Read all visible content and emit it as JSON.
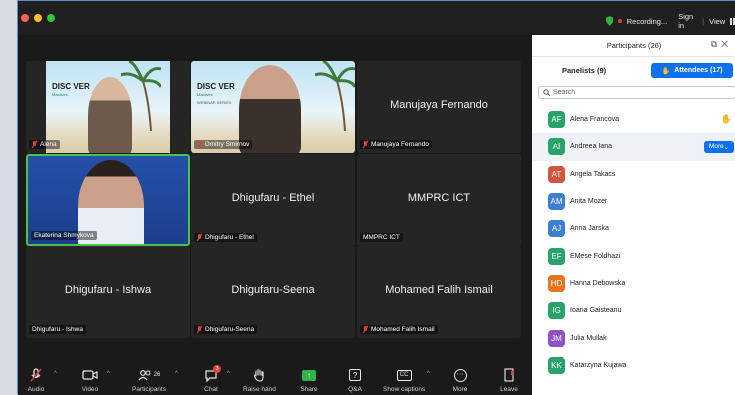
{
  "titlebar": {
    "recording": "Recording...",
    "sign_in": "Sign in",
    "separator": "|",
    "view": "View"
  },
  "tiles": [
    {
      "name": "Alena",
      "video": true,
      "muted": true
    },
    {
      "name": "Dmitry Smirnov",
      "video": true,
      "muted": true
    },
    {
      "name": "Manujaya Fernando",
      "label": "Manujaya Fernando",
      "video": false,
      "muted": true
    },
    {
      "name": "Ekaterina Shmykova",
      "video": true,
      "muted": false,
      "active": true
    },
    {
      "name": "Dhigufaru - Ethel",
      "label": "Dhigufaru - Ethel",
      "video": false,
      "muted": true
    },
    {
      "name": "MMPRC ICT",
      "label": "MMPRC ICT",
      "video": false,
      "muted": false
    },
    {
      "name": "Dhigufaru - Ishwa",
      "label": "Dhigufaru - Ishwa",
      "video": false,
      "muted": false
    },
    {
      "name": "Dhigufaru-Seena",
      "label": "Dhigufaru-Seena",
      "video": false,
      "muted": true
    },
    {
      "name": "Mohamed Falih Ismail",
      "label": "Mohamed Falih Ismail",
      "video": false,
      "muted": true
    }
  ],
  "logo": {
    "title": "DISC VER",
    "sub": "Maldives",
    "series": "WEBINAR SERIES"
  },
  "toolbar": {
    "audio": "Audio",
    "video": "Video",
    "participants": "Participants",
    "participants_count": "26",
    "chat": "Chat",
    "chat_badge": "3",
    "raise_hand": "Raise hand",
    "share": "Share",
    "qa": "Q&A",
    "captions": "Show captions",
    "more": "More",
    "leave": "Leave"
  },
  "panel": {
    "title": "Participants (26)",
    "tab_panelists": "Panelists (9)",
    "tab_attendees": "Attendees (17)",
    "search_placeholder": "Search",
    "more_button": "More",
    "attendees": [
      {
        "initials": "AF",
        "name": "Alena Francova",
        "color": "#27a36b",
        "hand": true
      },
      {
        "initials": "AI",
        "name": "Andreea Iana",
        "color": "#27a36b",
        "selected": true
      },
      {
        "initials": "AT",
        "name": "Angela Takacs",
        "color": "#d2553f"
      },
      {
        "initials": "AM",
        "name": "Anita Mozer",
        "color": "#3b7fd0"
      },
      {
        "initials": "AJ",
        "name": "Anna Jarska",
        "color": "#3b7fd0"
      },
      {
        "initials": "EF",
        "name": "EMese Foldhazi",
        "color": "#27a36b"
      },
      {
        "initials": "HD",
        "name": "Hanna Debowska",
        "color": "#e3761f"
      },
      {
        "initials": "IG",
        "name": "Ioana Gaisteanu",
        "color": "#27a36b"
      },
      {
        "initials": "JM",
        "name": "Julia Mullak",
        "color": "#9152c7"
      },
      {
        "initials": "KK",
        "name": "Katarzyna Kujawa",
        "color": "#27a36b"
      }
    ]
  }
}
